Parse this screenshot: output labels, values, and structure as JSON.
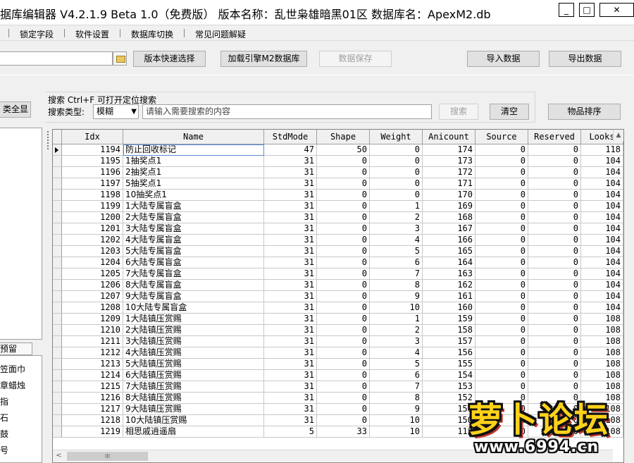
{
  "window": {
    "title": "据库编辑器 V4.2.1.9  Beta 1.0（免费版）   版本名称：乱世枭雄暗黑01区   数据库名：ApexM2.db",
    "min_label": "0",
    "max_label": "1",
    "close_label": "r"
  },
  "menu": {
    "items": [
      "锁定字段",
      "软件设置",
      "数据库切换",
      "常见问题解疑"
    ]
  },
  "toolbar": {
    "version_select": "版本快速选择",
    "load_db": "加载引擎M2数据库",
    "save_data": "数据保存",
    "import_data": "导入数据",
    "export_data": "导出数据"
  },
  "search": {
    "title": "搜索  Ctrl+F 可打开定位搜索",
    "type_label": "搜索类型:",
    "type_value": "模糊",
    "placeholder": "请输入需要搜索的内容",
    "search_btn": "搜索",
    "clear_btn": "清空",
    "sort_btn": "物品排序"
  },
  "left_panel": {
    "show_all_btn": "类全显",
    "tab_label": "预留",
    "items": [
      "笠面巾",
      "章蜡烛",
      "指",
      "石",
      "鼓",
      "号"
    ]
  },
  "grid": {
    "columns": [
      "Idx",
      "Name",
      "StdMode",
      "Shape",
      "Weight",
      "Anicount",
      "Source",
      "Reserved",
      "Looks"
    ],
    "rows": [
      [
        "1194",
        "防止回收标记",
        "47",
        "50",
        "0",
        "174",
        "0",
        "0",
        "118"
      ],
      [
        "1195",
        "1抽奖点1",
        "31",
        "0",
        "0",
        "173",
        "0",
        "0",
        "104"
      ],
      [
        "1196",
        "2抽奖点1",
        "31",
        "0",
        "0",
        "172",
        "0",
        "0",
        "104"
      ],
      [
        "1197",
        "5抽奖点1",
        "31",
        "0",
        "0",
        "171",
        "0",
        "0",
        "104"
      ],
      [
        "1198",
        "10抽奖点1",
        "31",
        "0",
        "0",
        "170",
        "0",
        "0",
        "104"
      ],
      [
        "1199",
        "1大陆专属盲盒",
        "31",
        "0",
        "1",
        "169",
        "0",
        "0",
        "104"
      ],
      [
        "1200",
        "2大陆专属盲盒",
        "31",
        "0",
        "2",
        "168",
        "0",
        "0",
        "104"
      ],
      [
        "1201",
        "3大陆专属盲盒",
        "31",
        "0",
        "3",
        "167",
        "0",
        "0",
        "104"
      ],
      [
        "1202",
        "4大陆专属盲盒",
        "31",
        "0",
        "4",
        "166",
        "0",
        "0",
        "104"
      ],
      [
        "1203",
        "5大陆专属盲盒",
        "31",
        "0",
        "5",
        "165",
        "0",
        "0",
        "104"
      ],
      [
        "1204",
        "6大陆专属盲盒",
        "31",
        "0",
        "6",
        "164",
        "0",
        "0",
        "104"
      ],
      [
        "1205",
        "7大陆专属盲盒",
        "31",
        "0",
        "7",
        "163",
        "0",
        "0",
        "104"
      ],
      [
        "1206",
        "8大陆专属盲盒",
        "31",
        "0",
        "8",
        "162",
        "0",
        "0",
        "104"
      ],
      [
        "1207",
        "9大陆专属盲盒",
        "31",
        "0",
        "9",
        "161",
        "0",
        "0",
        "104"
      ],
      [
        "1208",
        "10大陆专属盲盒",
        "31",
        "0",
        "10",
        "160",
        "0",
        "0",
        "104"
      ],
      [
        "1209",
        "1大陆镇压赏赐",
        "31",
        "0",
        "1",
        "159",
        "0",
        "0",
        "108"
      ],
      [
        "1210",
        "2大陆镇压赏赐",
        "31",
        "0",
        "2",
        "158",
        "0",
        "0",
        "108"
      ],
      [
        "1211",
        "3大陆镇压赏赐",
        "31",
        "0",
        "3",
        "157",
        "0",
        "0",
        "108"
      ],
      [
        "1212",
        "4大陆镇压赏赐",
        "31",
        "0",
        "4",
        "156",
        "0",
        "0",
        "108"
      ],
      [
        "1213",
        "5大陆镇压赏赐",
        "31",
        "0",
        "5",
        "155",
        "0",
        "0",
        "108"
      ],
      [
        "1214",
        "6大陆镇压赏赐",
        "31",
        "0",
        "6",
        "154",
        "0",
        "0",
        "108"
      ],
      [
        "1215",
        "7大陆镇压赏赐",
        "31",
        "0",
        "7",
        "153",
        "0",
        "0",
        "108"
      ],
      [
        "1216",
        "8大陆镇压赏赐",
        "31",
        "0",
        "8",
        "152",
        "0",
        "0",
        "108"
      ],
      [
        "1217",
        "9大陆镇压赏赐",
        "31",
        "0",
        "9",
        "151",
        "0",
        "0",
        "108"
      ],
      [
        "1218",
        "10大陆镇压赏赐",
        "31",
        "0",
        "10",
        "150",
        "0",
        "0",
        "108"
      ],
      [
        "1219",
        "相思戚逍遥扇",
        "5",
        "33",
        "10",
        "112",
        "0",
        "0",
        "108"
      ]
    ],
    "hscroll_thumb": "III"
  },
  "watermark": {
    "brand": "萝卜论坛",
    "url": "www.6994.cn"
  }
}
